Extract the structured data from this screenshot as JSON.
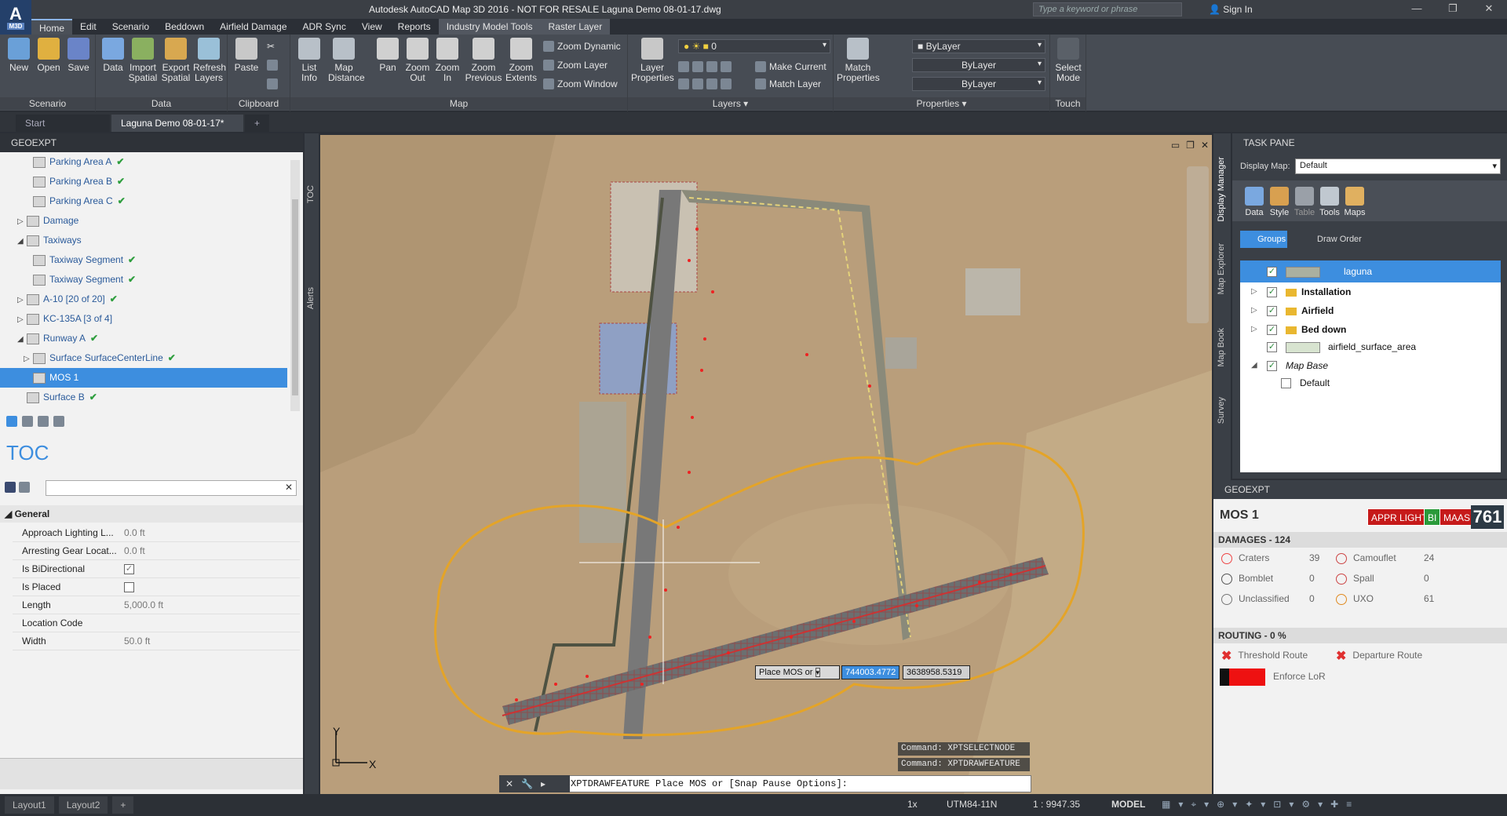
{
  "app": {
    "logo_text": "A",
    "logo_sub": "M3D",
    "title": "Autodesk AutoCAD Map 3D 2016 - NOT FOR RESALE    Laguna Demo 08-01-17.dwg",
    "search_placeholder": "Type a keyword or phrase",
    "signin": "Sign In"
  },
  "tabs": [
    "Home",
    "Edit",
    "Scenario",
    "Beddown",
    "Airfield Damage",
    "ADR Sync",
    "View",
    "Reports",
    "Industry Model Tools",
    "Raster Layer"
  ],
  "ribbon": {
    "scenario": {
      "label": "Scenario",
      "buttons": [
        "New",
        "Open",
        "Save"
      ]
    },
    "data": {
      "label": "Data",
      "buttons": [
        "Data",
        "Import\nSpatial",
        "Export\nSpatial",
        "Refresh\nLayers"
      ]
    },
    "clipboard": {
      "label": "Clipboard",
      "paste": "Paste"
    },
    "map": {
      "label": "Map",
      "buttons": [
        "List\nInfo",
        "Map\nDistance",
        "Pan",
        "Zoom\nOut",
        "Zoom\nIn",
        "Zoom\nPrevious",
        "Zoom\nExtents"
      ],
      "zoom_dynamic": "Zoom Dynamic",
      "zoom_layer": "Zoom Layer",
      "zoom_window": "Zoom Window"
    },
    "layers": {
      "label": "Layers",
      "layer_props": "Layer\nProperties",
      "current_layer": "0",
      "make_current": "Make Current",
      "match_layer": "Match Layer"
    },
    "properties": {
      "label": "Properties",
      "match": "Match\nProperties",
      "color": "ByLayer",
      "linetype": "ByLayer",
      "lineweight": "ByLayer"
    },
    "touch": {
      "label": "Touch",
      "select_mode": "Select\nMode"
    }
  },
  "doc_tabs": [
    "Start",
    "Laguna Demo 08-01-17*"
  ],
  "geoexpt_left": {
    "header": "GEOEXPT",
    "tree": [
      {
        "label": "Parking Area A",
        "indent": 2,
        "check": true
      },
      {
        "label": "Parking Area B",
        "indent": 2,
        "check": true
      },
      {
        "label": "Parking Area C",
        "indent": 2,
        "check": true
      },
      {
        "label": "Damage",
        "indent": 1,
        "check": false,
        "tri": "▷"
      },
      {
        "label": "Taxiways",
        "indent": 1,
        "check": false,
        "tri": "◢"
      },
      {
        "label": "Taxiway Segment",
        "indent": 2,
        "check": true
      },
      {
        "label": "Taxiway Segment",
        "indent": 2,
        "check": true
      },
      {
        "label": "A-10 [20 of 20]",
        "indent": 1,
        "check": true,
        "tri": "▷"
      },
      {
        "label": "KC-135A [3 of 4]",
        "indent": 1,
        "check": false,
        "tri": "▷"
      },
      {
        "label": "Runway A",
        "indent": 1,
        "check": true,
        "tri": "◢"
      },
      {
        "label": "Surface SurfaceCenterLine",
        "indent": 2,
        "check": true,
        "tri": "▷"
      },
      {
        "label": "MOS 1",
        "indent": 2,
        "check": false,
        "selected": true
      },
      {
        "label": "Surface B",
        "indent": 1,
        "check": true
      }
    ],
    "toc_title": "TOC",
    "section": "General",
    "props": [
      {
        "k": "Approach Lighting L...",
        "v": "0.0 ft"
      },
      {
        "k": "Arresting Gear Locat...",
        "v": "0.0 ft"
      },
      {
        "k": "Is BiDirectional",
        "v": "",
        "checkbox": true,
        "checked": true
      },
      {
        "k": "Is Placed",
        "v": "",
        "checkbox": true,
        "checked": false
      },
      {
        "k": "Length",
        "v": "5,000.0 ft"
      },
      {
        "k": "Location Code",
        "v": ""
      },
      {
        "k": "Width",
        "v": "50.0 ft"
      }
    ]
  },
  "side_tabs_left": [
    "TOC",
    "Alerts"
  ],
  "side_tabs_right": [
    "Display Manager",
    "Map Explorer",
    "Map Book",
    "Survey"
  ],
  "task_pane": {
    "header": "TASK PANE",
    "display_map_label": "Display Map:",
    "display_map": "Default",
    "tools": [
      "Data",
      "Style",
      "Table",
      "Tools",
      "Maps"
    ],
    "groups": "Groups",
    "draw_order": "Draw Order",
    "layers": [
      {
        "label": "laguna",
        "indent": 0,
        "selected": true
      },
      {
        "label": "Installation",
        "indent": 0,
        "bold": true,
        "folder": true,
        "tri": "▷"
      },
      {
        "label": "Airfield",
        "indent": 0,
        "bold": true,
        "folder": true,
        "tri": "▷"
      },
      {
        "label": "Bed down",
        "indent": 0,
        "bold": true,
        "folder": true,
        "tri": "▷"
      },
      {
        "label": "airfield_surface_area",
        "indent": 0
      },
      {
        "label": "Map Base",
        "indent": 0,
        "italic": true,
        "tri": "◢"
      },
      {
        "label": "Default",
        "indent": 1,
        "unchecked": true
      }
    ]
  },
  "geoexpt_right": {
    "header": "GEOEXPT",
    "title": "MOS 1",
    "badges": [
      "APPR LIGHT",
      "BI",
      "MAAS"
    ],
    "count": "761",
    "damages_header": "DAMAGES - 124",
    "damages": [
      {
        "name": "Craters",
        "value": "39"
      },
      {
        "name": "Camouflet",
        "value": "24"
      },
      {
        "name": "Bomblet",
        "value": "0"
      },
      {
        "name": "Spall",
        "value": "0"
      },
      {
        "name": "Unclassified",
        "value": "0"
      },
      {
        "name": "UXO",
        "value": "61"
      }
    ],
    "routing_header": "ROUTING - 0 %",
    "threshold": "Threshold Route",
    "departure": "Departure Route",
    "enforce": "Enforce LoR"
  },
  "map": {
    "prompt": "Place MOS or",
    "x_value": "744003.4772",
    "y_value": "3638958.5319",
    "cmd_history": [
      "Command:  XPTSELECTNODE",
      "Command:  XPTDRAWFEATURE"
    ],
    "cmd_line": "XPTDRAWFEATURE Place MOS or [Snap Pause Options]:",
    "axis_y": "Y",
    "axis_x": "X"
  },
  "status": {
    "layouts": [
      "Layout1",
      "Layout2"
    ],
    "scale_factor": "1x",
    "coord_system": "UTM84-11N",
    "map_scale": "1 : 9947.35",
    "model": "MODEL"
  },
  "colors": {
    "accent": "#3d8edf",
    "danger": "#c61a1a",
    "ribbon": "#474c54",
    "status_ok": "#2e9e3e"
  }
}
